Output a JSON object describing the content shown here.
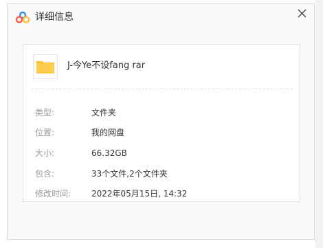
{
  "window": {
    "title": "详细信息",
    "logo_icon": "cloud-logo-icon",
    "close_icon": "close-icon",
    "close_glyph": "✕"
  },
  "file": {
    "icon": "folder-icon",
    "name": "J-今Ye不设fang rar"
  },
  "details": [
    {
      "label": "类型:",
      "value": "文件夹"
    },
    {
      "label": "位置:",
      "value": "我的网盘"
    },
    {
      "label": "大小:",
      "value": "66.32GB"
    },
    {
      "label": "包含:",
      "value": "33个文件,2个文件夹"
    },
    {
      "label": "修改时间:",
      "value": "2022年05月15日, 14:32"
    }
  ],
  "colors": {
    "folder": "#ffc234",
    "logo_blue": "#2e8ef0",
    "logo_yellow": "#ffc234",
    "logo_red": "#ff5a4d"
  }
}
